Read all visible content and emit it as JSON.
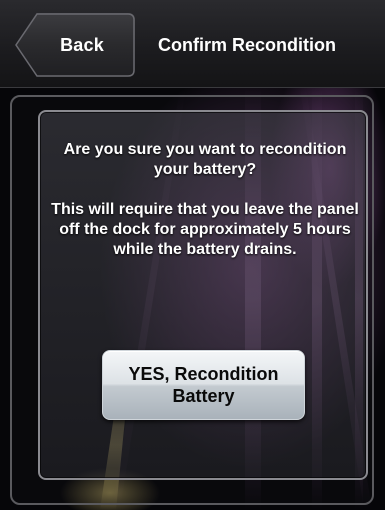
{
  "header": {
    "back_label": "Back",
    "title": "Confirm Recondition"
  },
  "dialog": {
    "question": "Are you sure you want to recondition your battery?",
    "detail": "This will require that you leave the panel off the dock for approximately 5 hours while the battery drains.",
    "confirm_line1": "YES, Recondition",
    "confirm_line2": "Battery"
  },
  "colors": {
    "text": "#ffffff",
    "button_text": "#0a0a0a",
    "panel_border": "#5a5a5e",
    "dialog_border": "#8a8a90"
  }
}
